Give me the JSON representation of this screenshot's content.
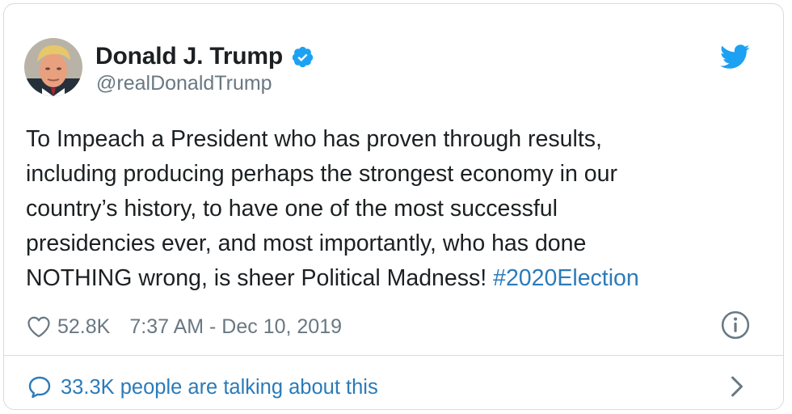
{
  "author": {
    "display_name": "Donald J. Trump",
    "handle": "@realDonaldTrump"
  },
  "tweet": {
    "text": "To Impeach a President who has proven through results,\nincluding producing perhaps the strongest economy in our\ncountry’s history, to have one of the most successful\npresidencies ever, and most importantly, who has done\nNOTHING wrong, is sheer Political Madness! ",
    "hashtag": "#2020Election"
  },
  "meta": {
    "likes": "52.8K",
    "timestamp": "7:37 AM - Dec 10, 2019"
  },
  "footer": {
    "talking_text": "33.3K people are talking about this"
  },
  "colors": {
    "text": "#1c2022",
    "secondary": "#697882",
    "link": "#2b7bb9",
    "twitter_blue": "#1da1f2",
    "border": "#d5dbe0"
  },
  "icons": [
    "avatar-photo",
    "verified-badge-icon",
    "twitter-bird-icon",
    "heart-icon",
    "info-icon",
    "speech-bubble-icon",
    "chevron-right-icon"
  ]
}
